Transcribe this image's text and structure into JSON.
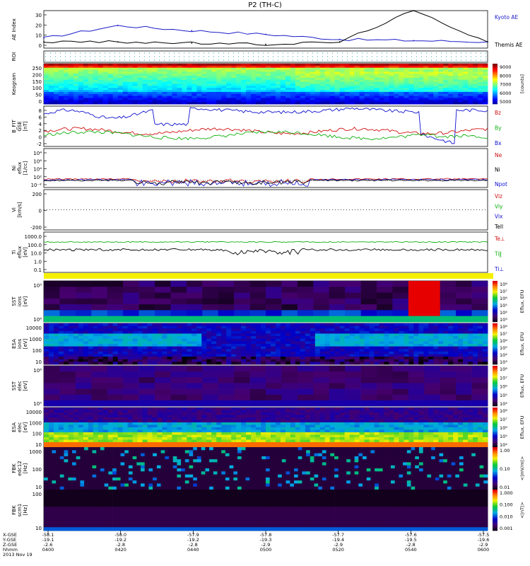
{
  "title": "P2 (TH-C)",
  "panels": [
    {
      "id": "ae",
      "ylabel": [
        "AE Index"
      ],
      "ticks": [
        "30",
        "20",
        "10",
        "0"
      ],
      "legend": [
        {
          "label": "Kyoto AE",
          "color": "#1c1cc8"
        },
        {
          "label": "Themis AE",
          "color": "#000000"
        }
      ]
    },
    {
      "id": "roi",
      "ylabel": [
        "ROI"
      ],
      "ticks": [],
      "legend": []
    },
    {
      "id": "keogram",
      "ylabel": [
        "Keogram"
      ],
      "ticks": [
        "250",
        "200",
        "150",
        "100",
        "50",
        "0"
      ],
      "legend": []
    },
    {
      "id": "bfit",
      "ylabel": [
        "B_FIT",
        "GSE",
        "[nT]"
      ],
      "ticks": [
        "8",
        "6",
        "4",
        "2",
        "0",
        "-2"
      ],
      "legend": [
        {
          "label": "Bz",
          "color": "#d01010"
        },
        {
          "label": "By",
          "color": "#10b010"
        },
        {
          "label": "Bx",
          "color": "#1010d0"
        }
      ]
    },
    {
      "id": "ni",
      "ylabel": [
        "Ni",
        "eflux",
        "[1/cc]"
      ],
      "ticks": [
        "10⁴",
        "10⁶",
        "10⁴",
        "10²",
        "10⁻²"
      ],
      "legend": [
        {
          "label": "Ne",
          "color": "#d01010"
        },
        {
          "label": "Ni",
          "color": "#000000"
        },
        {
          "label": "Npot",
          "color": "#1010d0"
        }
      ]
    },
    {
      "id": "vi",
      "ylabel": [
        "Vi",
        "[km/s]"
      ],
      "ticks": [
        "200",
        "0",
        "-200"
      ],
      "legend": [
        {
          "label": "Viz",
          "color": "#d01010"
        },
        {
          "label": "Viy",
          "color": "#10b010"
        },
        {
          "label": "Vix",
          "color": "#1010d0"
        },
        {
          "label": "Tell",
          "color": "#000000"
        }
      ]
    },
    {
      "id": "ti",
      "ylabel": [
        "Ti",
        "eflux",
        "[eV]"
      ],
      "ticks": [
        "1000.0",
        "100.0",
        "10.0",
        "1.0",
        "0.1"
      ],
      "legend": [
        {
          "label": "Te⊥",
          "color": "#d01010"
        },
        {
          "label": "Ti‖",
          "color": "#10b010"
        },
        {
          "label": "Ti⊥",
          "color": "#1010d0"
        }
      ]
    },
    {
      "id": "sst_i",
      "ylabel": [
        "SST",
        "ions",
        "[eV]"
      ],
      "ticks": [
        "10⁵",
        "10⁶"
      ],
      "legend": []
    },
    {
      "id": "esa_i",
      "ylabel": [
        "ESA",
        "ions",
        "[eV]"
      ],
      "ticks": [
        "10000",
        "1000",
        "100",
        "10"
      ],
      "legend": []
    },
    {
      "id": "sst_e",
      "ylabel": [
        "SST",
        "elec",
        "[eV]"
      ],
      "ticks": [
        "10⁶",
        "10⁵"
      ],
      "legend": []
    },
    {
      "id": "esa_e",
      "ylabel": [
        "ESA",
        "elec",
        "[eV]"
      ],
      "ticks": [
        "10000",
        "1000",
        "100",
        "10"
      ],
      "legend": []
    },
    {
      "id": "fbk1",
      "ylabel": [
        "FBK",
        "edc12",
        "[Hz]"
      ],
      "ticks": [
        "1000",
        "100",
        "10"
      ],
      "legend": []
    },
    {
      "id": "fbk2",
      "ylabel": [
        "FBK",
        "scm1",
        "[Hz]"
      ],
      "ticks": [
        "100",
        "10"
      ],
      "legend": []
    }
  ],
  "colorbars": [
    {
      "id": "keogram",
      "label": "[counts]",
      "ticks": [
        "9000",
        "8000",
        "7000",
        "6000",
        "5000"
      ]
    },
    {
      "id": "sst_i",
      "label": "Eflux, EFU",
      "ticks": [
        "10⁸",
        "10⁷",
        "10⁶",
        "10⁵",
        "10⁴",
        "10³"
      ]
    },
    {
      "id": "esa_i",
      "label": "Eflux, EFU",
      "ticks": [
        "10⁸",
        "10⁷",
        "10⁶",
        "10⁵",
        "10⁴",
        "10³"
      ]
    },
    {
      "id": "sst_e",
      "label": "Eflux, EFU",
      "ticks": [
        "10⁸",
        "10⁷",
        "10⁶",
        "10⁵",
        "10⁴"
      ]
    },
    {
      "id": "esa_e",
      "label": "Eflux, EFU",
      "ticks": [
        "10⁸",
        "10⁷",
        "10⁶",
        "10⁵",
        "10⁴"
      ]
    },
    {
      "id": "fbk1",
      "label": "<|mV/m|>",
      "ticks": [
        "1.00",
        "0.10",
        "0.01"
      ]
    },
    {
      "id": "fbk2",
      "label": "<|nT|>",
      "ticks": [
        "1.000",
        "0.100",
        "0.010",
        "0.001"
      ]
    }
  ],
  "footer": {
    "row_labels": [
      "X-GSE",
      "Y-GSE",
      "Z-GSE",
      "hhmm",
      "2013 Nov 19"
    ],
    "columns": [
      {
        "x": "-58.1",
        "y": "-19.1",
        "z": "-2.6",
        "t": "0400"
      },
      {
        "x": "-58.0",
        "y": "-19.2",
        "z": "-2.8",
        "t": "0420"
      },
      {
        "x": "-57.9",
        "y": "-19.2",
        "z": "-2.8",
        "t": "0440"
      },
      {
        "x": "-57.8",
        "y": "-19.3",
        "z": "-2.9",
        "t": "0500"
      },
      {
        "x": "-57.7",
        "y": "-19.4",
        "z": "-2.9",
        "t": "0520"
      },
      {
        "x": "-57.6",
        "y": "-19.5",
        "z": "-2.8",
        "t": "0540"
      },
      {
        "x": "-57.5",
        "y": "-19.6",
        "z": "-2.9",
        "t": "0600"
      }
    ]
  },
  "chart_data": {
    "type": "line",
    "title": "P2 (TH-C)",
    "x_unit": "hhmm",
    "x": [
      "0400",
      "0420",
      "0440",
      "0500",
      "0520",
      "0540",
      "0600"
    ],
    "series": [
      {
        "name": "Kyoto AE",
        "values": [
          8,
          18,
          14,
          11,
          7,
          6,
          5
        ]
      },
      {
        "name": "Themis AE",
        "values": [
          5,
          5,
          4,
          3,
          5,
          30,
          5
        ]
      }
    ],
    "ylabel": "AE Index",
    "ylim": [
      0,
      30
    ]
  }
}
